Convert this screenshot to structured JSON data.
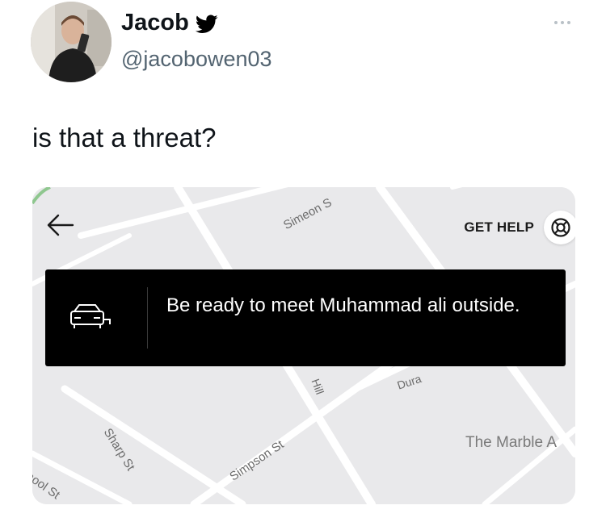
{
  "tweet": {
    "display_name": "Jacob",
    "handle": "@jacobowen03",
    "text": "is that a threat?"
  },
  "icons": {
    "verified": "twitter-bird-icon",
    "more": "more-dots-icon",
    "back": "arrow-left-icon",
    "help": "lifebuoy-icon",
    "car": "car-icon"
  },
  "media": {
    "help_label": "GET HELP",
    "message": "Be ready to meet Muhammad ali outside.",
    "streets": {
      "simeon": "Simeon S",
      "sharp": "Sharp St",
      "simpson": "Simpson St",
      "school": "hool St",
      "hill": "Hill",
      "dura": "Dura",
      "marble": "The Marble A"
    }
  },
  "colors": {
    "bird": "#000000",
    "handle": "#536471",
    "banner_bg": "#000000",
    "map_bg": "#e9e9eb"
  }
}
